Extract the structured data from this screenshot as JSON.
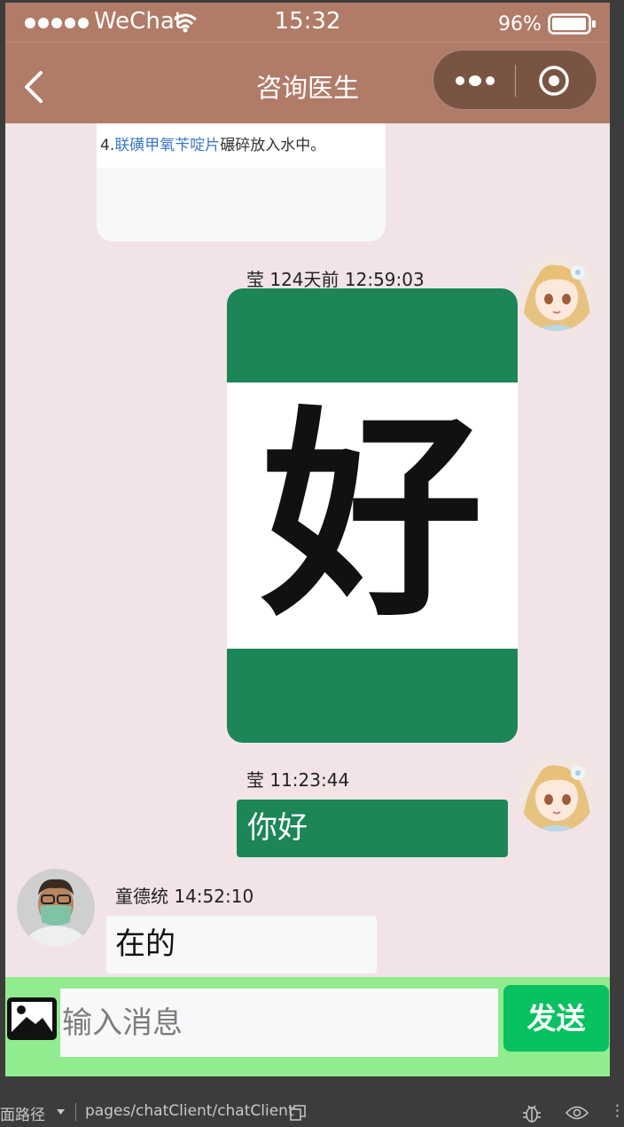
{
  "status_bar": {
    "carrier": "WeChat",
    "time": "15:32",
    "battery": "96%"
  },
  "nav": {
    "title": "咨询医生"
  },
  "article": {
    "prefix": "4.",
    "link_text": "联磺甲氧苄啶片",
    "suffix": "碾碎放入水中。"
  },
  "messages": [
    {
      "sender": "莹",
      "time": "124天前 12:59:03",
      "meta": "莹 124天前 12:59:03",
      "type": "image",
      "image_text": "好",
      "side": "right"
    },
    {
      "sender": "莹",
      "time": "11:23:44",
      "meta": "莹 11:23:44",
      "type": "text",
      "text": "你好",
      "side": "right"
    },
    {
      "sender": "童德统",
      "time": "14:52:10",
      "meta": "童德统 14:52:10",
      "type": "text",
      "text": "在的",
      "side": "left"
    }
  ],
  "input": {
    "placeholder": "输入消息",
    "send_label": "发送"
  },
  "devtools": {
    "path_label": "面路径",
    "path": "pages/chatClient/chatClient",
    "more": "⋮"
  },
  "colors": {
    "nav_bg": "#b07c68",
    "chat_bg": "#f2e4e6",
    "bubble_green": "#1c8656",
    "input_bar_bg": "#90ec8e",
    "send_button": "#08c160"
  },
  "icons": [
    "wifi-icon",
    "battery-icon",
    "back-icon",
    "more-icon",
    "close-icon",
    "image-icon",
    "copy-icon",
    "bug-icon",
    "eye-icon"
  ]
}
